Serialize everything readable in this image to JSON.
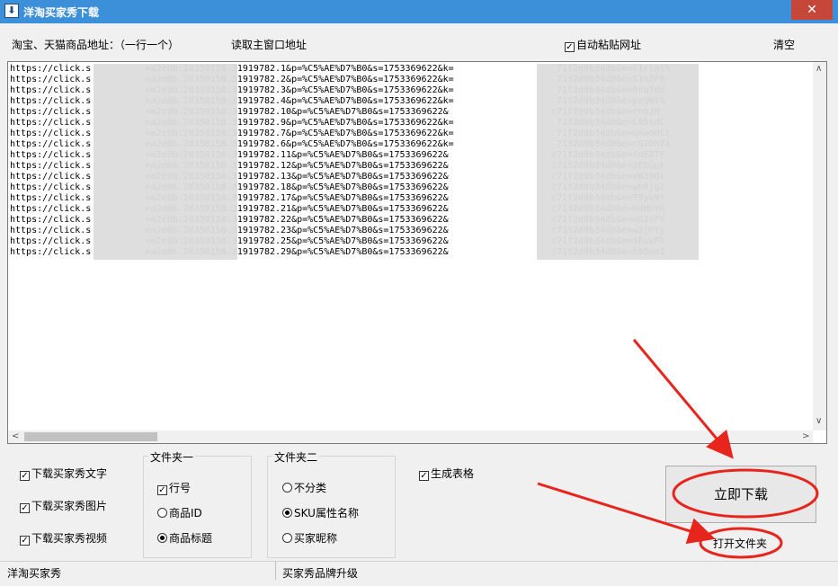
{
  "window": {
    "title": "洋淘买家秀下载",
    "close_glyph": "✕"
  },
  "top": {
    "url_label": "淘宝、天猫商品地址：（一行一个）",
    "read_main_window": "读取主窗口地址",
    "auto_paste": {
      "label": "自动粘贴网址",
      "checked": true
    },
    "clear": "清空"
  },
  "urls": [
    "https://click.s          =a2e0b.20350158.31919782.1&p=%C5%AE%D7%B0&s=1753369622&k=                   71f2d9b34db&e=l1rtal%",
    "https://click.s          =a2e0b.20350158.31919782.2&p=%C5%AE%D7%B0&s=1753369622&k=                   71f2d9b34db&e=S1%2F0",
    "https://click.s          =a2e0b.20350158.31919782.3&p=%C5%AE%D7%B0&s=1753369622&k=                   71f2d9b34db&e=9rq7dU",
    "https://click.s          =a2e0b.20350158.31919782.4&p=%C5%AE%D7%B0&s=1753369622&k=                   71f2d9b34db&e=pzQWl%",
    "https://click.s          =a2e0b.20350158.31919782.10&p=%C5%AE%D7%B0&s=1753369622&                   c71f2d9b34db&e=rnbJH",
    "https://click.s          =a2e0b.20350158.31919782.9&p=%C5%AE%D7%B0&s=1753369622&k=                   71f2d9b34db&e=LA5tdC",
    "https://click.s          =a2e0b.20350158.31919782.7&p=%C5%AE%D7%B0&s=1753369622&k=                   71f2d9b34db&e=uAwoHCt",
    "https://click.s          =a2e0b.20350158.31919782.6&p=%C5%AE%D7%B0&s=1753369622&k=                   71f2d9b34db&e=cOZOhT4",
    "https://click.s          =a2e0b.20350158.31919782.11&p=%C5%AE%D7%B0&s=1753369622&                   c71f2d9b34db&e=fdEZ7F",
    "https://click.s          =a2e0b.20350158.31919782.12&p=%C5%AE%D7%B0&s=1753369622&                   c71f2d9b34db&e=JESQpk",
    "https://click.s          =a2e0b.20350158.31919782.13&p=%C5%AE%D7%B0&s=1753369622&                   c71f2d9b34db&e=xW39Qc",
    "https://click.s          =a2e0b.20350158.31919782.18&p=%C5%AE%D7%B0&s=1753369622&                   c71f2d9b34db&e=wb8jg2",
    "https://click.s          =a2e0b.20350158.31919782.17&p=%C5%AE%D7%B0&s=1753369622&                   c71f2d9b34db&e=T9yv9t",
    "https://click.s          =a2e0b.20350158.31919782.21&p=%C5%AE%D7%B0&s=1753369622&                   c71f2d9b34db&e=HdHbY6",
    "https://click.s          =a2e0b.20350158.31919782.22&p=%C5%AE%D7%B0&s=1753369622&                   c71f2d9b34db&e=oOJxFV",
    "https://click.s          =a2e0b.20350158.31919782.23&p=%C5%AE%D7%B0&s=1753369622&                   c71f2d9b34db&e=wzjRty",
    "https://click.s          =a2e0b.20350158.31919782.25&p=%C5%AE%D7%B0&s=1753369622&                   c71f2d9b34db&e=4EuvFh",
    "https://click.s          =a2e0b.20350158.31919782.29&p=%C5%AE%D7%B0&s=1753369622&                   c71f2d9b34db&e=k95waI"
  ],
  "options": {
    "download_text": {
      "label": "下载买家秀文字",
      "checked": true
    },
    "download_images": {
      "label": "下载买家秀图片",
      "checked": true
    },
    "download_video": {
      "label": "下载买家秀视频",
      "checked": true
    }
  },
  "folder1": {
    "title": "文件夹一",
    "row_number": {
      "label": "行号",
      "checked": true
    },
    "product_id": {
      "label": "商品ID",
      "selected": false
    },
    "product_title": {
      "label": "商品标题",
      "selected": true
    }
  },
  "folder2": {
    "title": "文件夹二",
    "no_category": {
      "label": "不分类",
      "selected": false
    },
    "sku_name": {
      "label": "SKU属性名称",
      "selected": true
    },
    "buyer_nickname": {
      "label": "买家昵称",
      "selected": false
    }
  },
  "generate_table": {
    "label": "生成表格",
    "checked": true
  },
  "buttons": {
    "download_now": "立即下载",
    "open_folder": "打开文件夹"
  },
  "statusbar": {
    "left": "洋淘买家秀",
    "right": "买家秀品牌升级"
  },
  "scroll_glyphs": {
    "up": "∧",
    "down": "∨",
    "left": "<",
    "right": ">"
  },
  "colors": {
    "titlebar": "#3c8fd9",
    "close": "#c7463a",
    "annotation": "#e8251c"
  }
}
